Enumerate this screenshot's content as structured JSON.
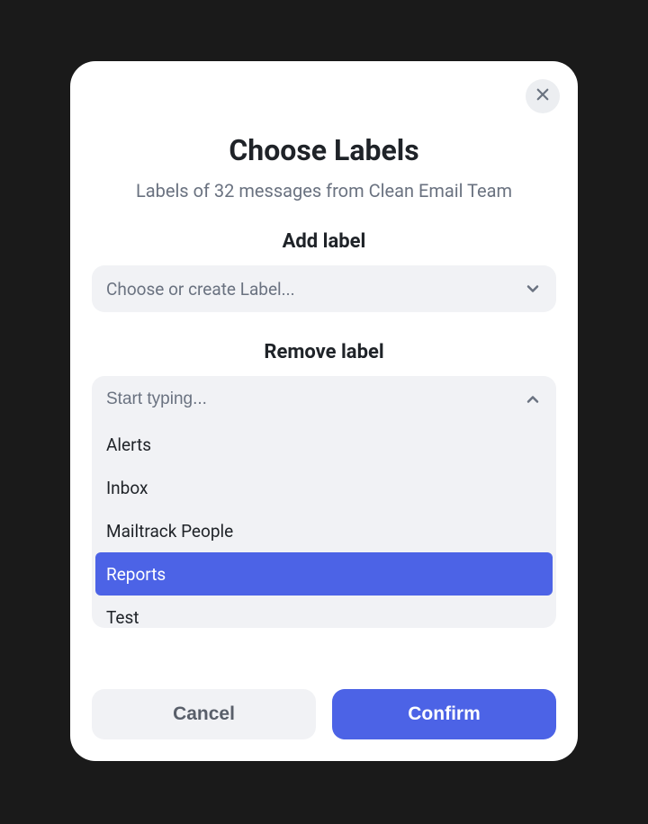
{
  "modal": {
    "title": "Choose Labels",
    "subtitle": "Labels of 32 messages from Clean Email Team",
    "add": {
      "heading": "Add label",
      "placeholder": "Choose or create Label..."
    },
    "remove": {
      "heading": "Remove label",
      "placeholder": "Start typing...",
      "options": {
        "0": "Alerts",
        "1": "Inbox",
        "2": "Mailtrack People",
        "3": "Reports",
        "4": "Test"
      },
      "selectedIndex": 3
    },
    "buttons": {
      "cancel": "Cancel",
      "confirm": "Confirm"
    }
  }
}
